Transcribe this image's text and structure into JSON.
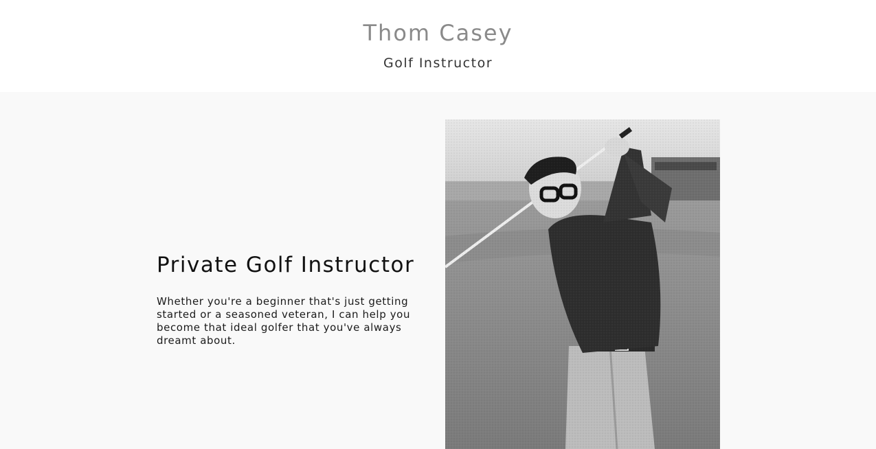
{
  "header": {
    "site_title": "Thom Casey",
    "site_subtitle": "Golf Instructor"
  },
  "hero": {
    "heading": "Private Golf Instructor",
    "body": "Whether you're a beginner that's just getting started or a seasoned veteran, I can help you become that ideal golfer that you've always dreamt about.",
    "photo_description_name": "golfer-photo"
  },
  "colors": {
    "header_bg": "#ffffff",
    "main_bg": "#f9f9f9",
    "title_gray": "#8a8a8a",
    "text_dark": "#111111"
  }
}
